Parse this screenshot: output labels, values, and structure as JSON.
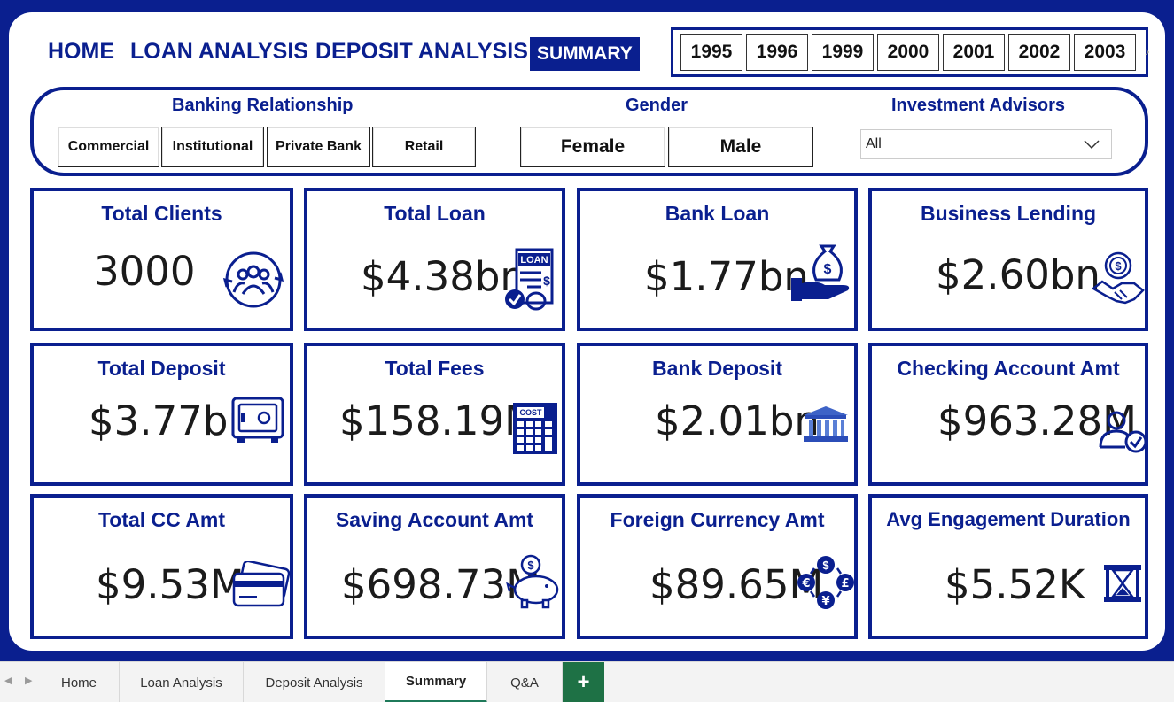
{
  "nav": {
    "home": "HOME",
    "loan_analysis": "LOAN ANALYSIS",
    "deposit_analysis": "DEPOSIT ANALYSIS",
    "summary": "SUMMARY"
  },
  "years": [
    "1995",
    "1996",
    "1999",
    "2000",
    "2001",
    "2002",
    "2003"
  ],
  "filters": {
    "banking_relationship": {
      "label": "Banking Relationship",
      "options": [
        "Commercial",
        "Institutional",
        "Private Bank",
        "Retail"
      ]
    },
    "gender": {
      "label": "Gender",
      "options": [
        "Female",
        "Male"
      ]
    },
    "investment_advisors": {
      "label": "Investment Advisors",
      "selected": "All"
    }
  },
  "cards": [
    {
      "title": "Total Clients",
      "value": "3000",
      "icon": "clients-icon"
    },
    {
      "title": "Total Loan",
      "value": "$4.38bn",
      "icon": "loan-document-icon",
      "icon_text": "LOAN"
    },
    {
      "title": "Bank Loan",
      "value": "$1.77bn",
      "icon": "money-bag-hand-icon"
    },
    {
      "title": "Business Lending",
      "value": "$2.60bn",
      "icon": "handshake-dollar-icon"
    },
    {
      "title": "Total Deposit",
      "value": "$3.77bn",
      "icon": "safe-icon"
    },
    {
      "title": "Total Fees",
      "value": "$158.19M",
      "icon": "calculator-icon",
      "icon_text": "COST"
    },
    {
      "title": "Bank Deposit",
      "value": "$2.01bn",
      "icon": "bank-building-icon"
    },
    {
      "title": "Checking Account Amt",
      "value": "$963.28M",
      "icon": "user-check-icon"
    },
    {
      "title": "Total CC Amt",
      "value": "$9.53M",
      "icon": "credit-card-icon"
    },
    {
      "title": "Saving Account Amt",
      "value": "$698.73M",
      "icon": "piggy-bank-icon"
    },
    {
      "title": "Foreign Currency Amt",
      "value": "$89.65M",
      "icon": "currency-exchange-icon"
    },
    {
      "title": "Avg Engagement Duration",
      "value": "$5.52K",
      "icon": "hourglass-icon"
    }
  ],
  "tabs": [
    "Home",
    "Loan Analysis",
    "Deposit Analysis",
    "Summary",
    "Q&A"
  ],
  "active_tab": "Summary",
  "add_tab_label": "+",
  "colors": {
    "brand_navy": "#0a1f8f",
    "tab_accent_green": "#1e7145"
  }
}
